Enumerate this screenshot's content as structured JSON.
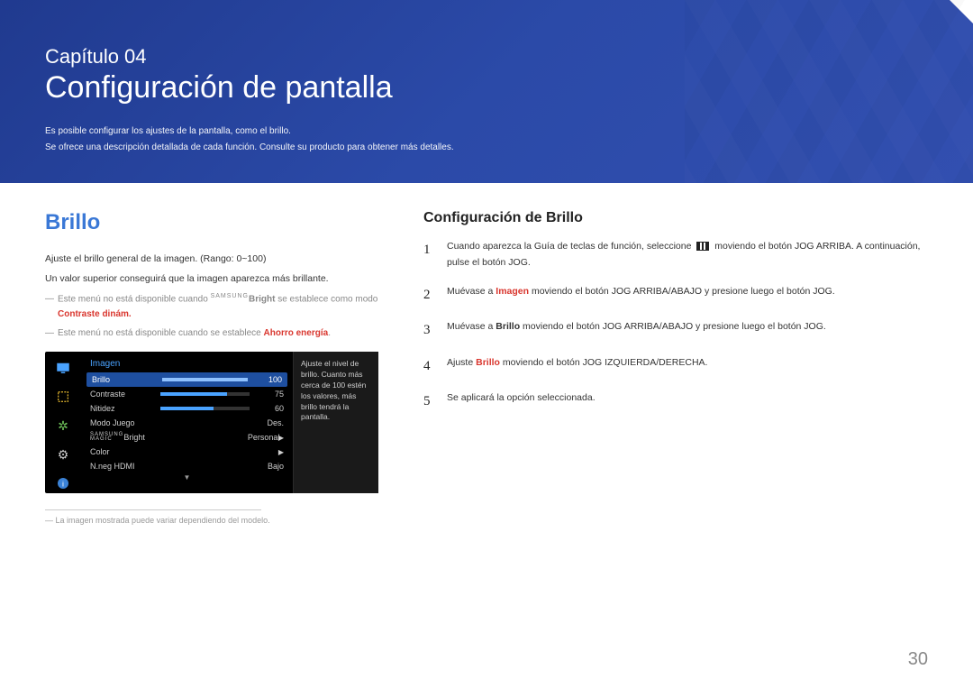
{
  "banner": {
    "chapter_label": "Capítulo 04",
    "chapter_title": "Configuración de pantalla",
    "sub1": "Es posible configurar los ajustes de la pantalla, como el brillo.",
    "sub2": "Se ofrece una descripción detallada de cada función. Consulte su producto para obtener más detalles."
  },
  "left": {
    "heading": "Brillo",
    "p1": "Ajuste el brillo general de la imagen. (Rango: 0~100)",
    "p2": "Un valor superior conseguirá que la imagen aparezca más brillante.",
    "note1_a": "Este menú no está disponible cuando ",
    "note1_magic_prefix": "SAMSUNG",
    "note1_magic_suffix": "Bright",
    "note1_b": " se establece como modo ",
    "note1_c": "Contraste dinám.",
    "note2_a": "Este menú no está disponible cuando se establece ",
    "note2_b": "Ahorro energía",
    "note2_c": ".",
    "footnote_marker": "―",
    "footnote": "La imagen mostrada puede variar dependiendo del modelo."
  },
  "osd": {
    "header": "Imagen",
    "rows": [
      {
        "label": "Brillo",
        "value": "100",
        "bar_pct": 100,
        "selected": true
      },
      {
        "label": "Contraste",
        "value": "75",
        "bar_pct": 75
      },
      {
        "label": "Nitidez",
        "value": "60",
        "bar_pct": 60
      },
      {
        "label": "Modo Juego",
        "value": "Des."
      },
      {
        "label_prefix": "SAMSUNG",
        "label_prefix2": "MAGIC",
        "label_suffix": "Bright",
        "value": "Personal",
        "arrow": true
      },
      {
        "label": "Color",
        "value": "",
        "arrow": true
      },
      {
        "label": "N.neg HDMI",
        "value": "Bajo"
      }
    ],
    "help": "Ajuste el nivel de brillo. Cuanto más cerca de 100 estén los valores, más brillo tendrá la pantalla.",
    "icons": [
      "monitor",
      "frame",
      "sun",
      "gear",
      "info"
    ]
  },
  "right": {
    "heading": "Configuración de Brillo",
    "steps": [
      {
        "n": "1",
        "pre": "Cuando aparezca la Guía de teclas de función, seleccione ",
        "icon": true,
        "post": " moviendo el botón JOG ARRIBA. A continuación, pulse el botón JOG."
      },
      {
        "n": "2",
        "pre": "Muévase a ",
        "bold_red": "Imagen",
        "post": " moviendo el botón JOG ARRIBA/ABAJO y presione luego el botón JOG."
      },
      {
        "n": "3",
        "pre": "Muévase a ",
        "bold": "Brillo",
        "post": " moviendo el botón JOG ARRIBA/ABAJO y presione luego el botón JOG."
      },
      {
        "n": "4",
        "pre": "Ajuste ",
        "bold_red": "Brillo",
        "post": " moviendo el botón JOG IZQUIERDA/DERECHA."
      },
      {
        "n": "5",
        "pre": "Se aplicará la opción seleccionada."
      }
    ]
  },
  "page_number": "30"
}
